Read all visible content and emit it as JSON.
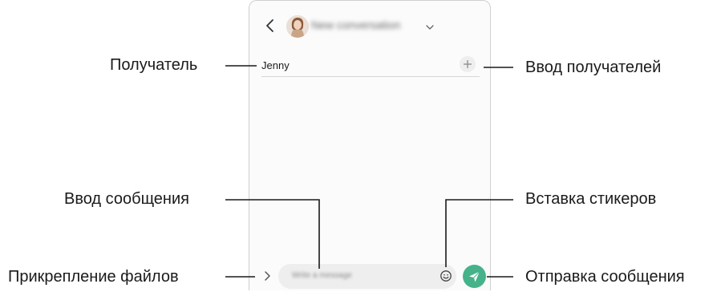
{
  "header": {
    "title": "New conversation"
  },
  "recipients": {
    "name": "Jenny"
  },
  "composer": {
    "placeholder": "Write a message"
  },
  "callouts": {
    "recipient": "Получатель",
    "add_recipients": "Ввод получателей",
    "message_input": "Ввод сообщения",
    "insert_stickers": "Вставка стикеров",
    "attach_files": "Прикрепление файлов",
    "send_message": "Отправка сообщения"
  },
  "colors": {
    "send_button": "#46b28a",
    "callout_line": "#1a1a1a",
    "input_background": "#eeeeee"
  },
  "icons": {
    "back": "chevron-left-icon",
    "title_dropdown": "chevron-down-icon",
    "add_recipient": "plus-icon",
    "attach": "chevron-right-icon",
    "stickers": "smiley-icon",
    "send": "paper-plane-icon"
  }
}
